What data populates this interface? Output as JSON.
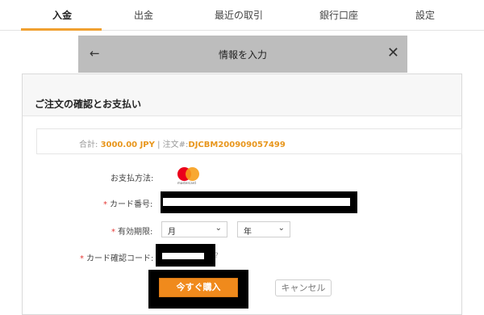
{
  "tabs": [
    {
      "label": "入金"
    },
    {
      "label": "出金"
    },
    {
      "label": "最近の取引"
    },
    {
      "label": "銀行口座"
    },
    {
      "label": "設定"
    }
  ],
  "modal": {
    "back_icon": "←",
    "title": "情報を入力",
    "close_icon": "✕"
  },
  "panel": {
    "heading": "ご注文の確認とお支払い"
  },
  "summary": {
    "total_label": "合計:",
    "total_amount": "3000.00 JPY",
    "separator": "|",
    "order_label": "注文#:",
    "order_id": "DJCBM200909057499"
  },
  "form": {
    "payment_method_label": "お支払方法:",
    "payment_brand_text": "mastercard",
    "card_number_label": "カード番号:",
    "expiry_label": "有効期限:",
    "month_value": "月",
    "year_value": "年",
    "cvc_label": "カード確認コード:",
    "help_icon": "?",
    "required_mark": "*"
  },
  "buttons": {
    "buy": "今すぐ購入",
    "cancel": "キャンセル"
  },
  "colors": {
    "accent": "#f08a1c",
    "order_text": "#e8961c",
    "required": "#e53935",
    "modal_header": "#bdbdbd"
  }
}
